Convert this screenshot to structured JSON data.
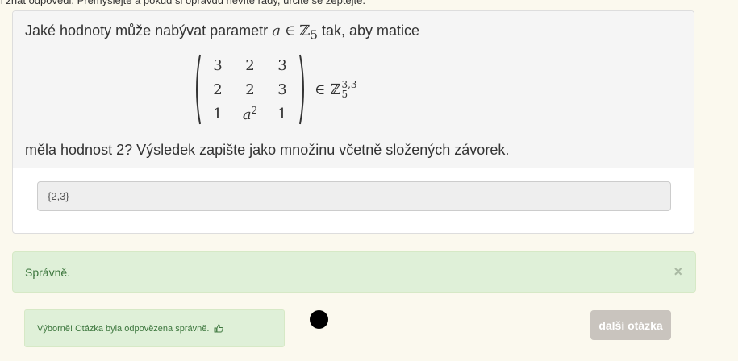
{
  "header_text": "il znát odpovědi. Přemýšlejte a pokud si opravdu nevíte rady, určitě se zeptejte.",
  "question": {
    "intro_text": "Jaké hodnoty může nabývat parametr",
    "param": "a",
    "in_symbol": "∈",
    "set_symbol": "ℤ",
    "set_sub": "5",
    "intro_tail": "tak, aby matice",
    "matrix": {
      "rows": [
        [
          "3",
          "2",
          "3"
        ],
        [
          "2",
          "2",
          "3"
        ],
        [
          "1",
          "a",
          "1"
        ]
      ],
      "a_exponent": "2",
      "in_symbol": "∈",
      "set_symbol": "ℤ",
      "set_sup": "3,3",
      "set_sub": "5"
    },
    "end_text": "měla hodnost 2? Výsledek zapište jako množinu včetně složených závorek."
  },
  "answer": {
    "value": "{2,3}"
  },
  "alert": {
    "text": "Správně.",
    "close": "×"
  },
  "feedback": {
    "text": "Výborně! Otázka byla odpovězena správně.",
    "icon": "thumbs-up-icon"
  },
  "next_button": {
    "label": "další otázka"
  },
  "colors": {
    "success_bg": "#dff0d8",
    "success_text": "#3c763d",
    "button_bg": "#c9c4be"
  }
}
